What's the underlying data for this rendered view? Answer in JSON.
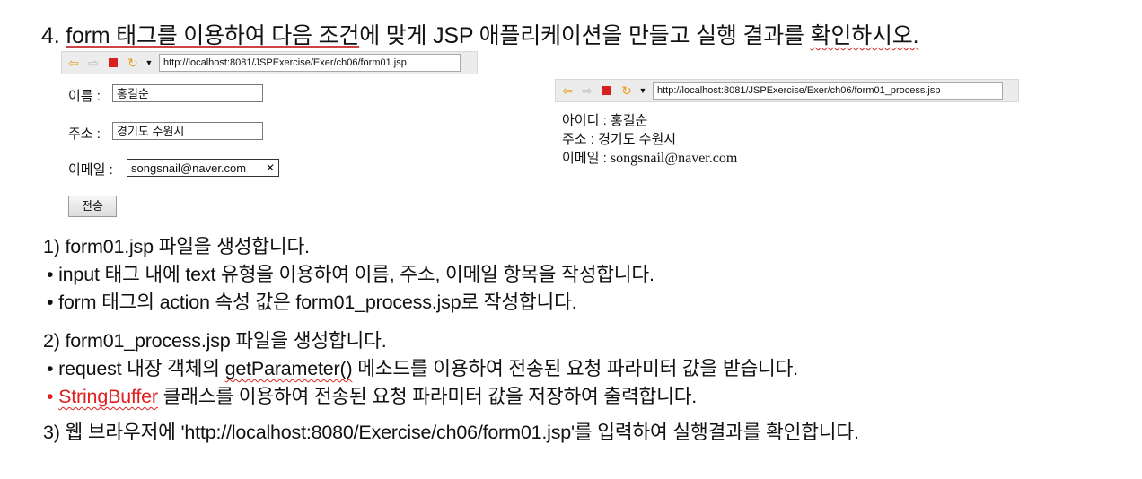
{
  "title": {
    "number": "4.",
    "part1": "form 태그를 이용하여 다음 조건",
    "part2": "에 맞게 JSP 애플리케이션을 만들고 실행 결과를 ",
    "part3": "확인하시오."
  },
  "left_browser": {
    "icons": [
      "back-arrow-icon",
      "forward-arrow-icon",
      "stop-icon",
      "refresh-icon",
      "dropdown-icon"
    ],
    "url": "http://localhost:8081/JSPExercise/Exer/ch06/form01.jsp",
    "form": {
      "name_label": "이름 :",
      "name_value": "홍길순",
      "address_label": "주소 :",
      "address_value": "경기도 수원시",
      "email_label": "이메일 :",
      "email_value": "songsnail@naver.com",
      "clear_glyph": "✕",
      "submit_label": "전송"
    }
  },
  "right_browser": {
    "url": "http://localhost:8081/JSPExercise/Exer/ch06/form01_process.jsp",
    "results": [
      {
        "label": "아이디 :",
        "value": "홍길순"
      },
      {
        "label": "주소 :",
        "value": "경기도 수원시"
      },
      {
        "label": "이메일 :",
        "value": "songsnail@naver.com"
      }
    ]
  },
  "steps": {
    "s1": {
      "heading": "1) form01.jsp 파일을 생성합니다.",
      "b1": "• input 태그 내에 text 유형을 이용하여 이름, 주소, 이메일 항목을 작성합니다.",
      "b2": "• form 태그의 action 속성 값은 form01_process.jsp로 작성합니다."
    },
    "s2": {
      "heading": "2) form01_process.jsp 파일을 생성합니다.",
      "b1_pre": "• request 내장 객체의 ",
      "b1_method": "getParameter()",
      "b1_post": " 메소드를 이용하여 전송된 요청 파라미터 값을 받습니다.",
      "b2_bullet": "• ",
      "b2_class": "StringBuffer",
      "b2_post": " 클래스를 이용하여 전송된 요청 파라미터 값을 저장하여 출력합니다."
    },
    "s3": {
      "heading": "3) 웹 브라우저에 'http://localhost:8080/Exercise/ch06/form01.jsp'를 입력하여 실행결과를 확인합니다."
    }
  },
  "colors": {
    "highlight_red": "#e02020",
    "toolbar_bg": "#ececec",
    "refresh_icon": "#e8a020",
    "back_forward_icon": "#e8a020",
    "stop_icon": "#d82020"
  }
}
